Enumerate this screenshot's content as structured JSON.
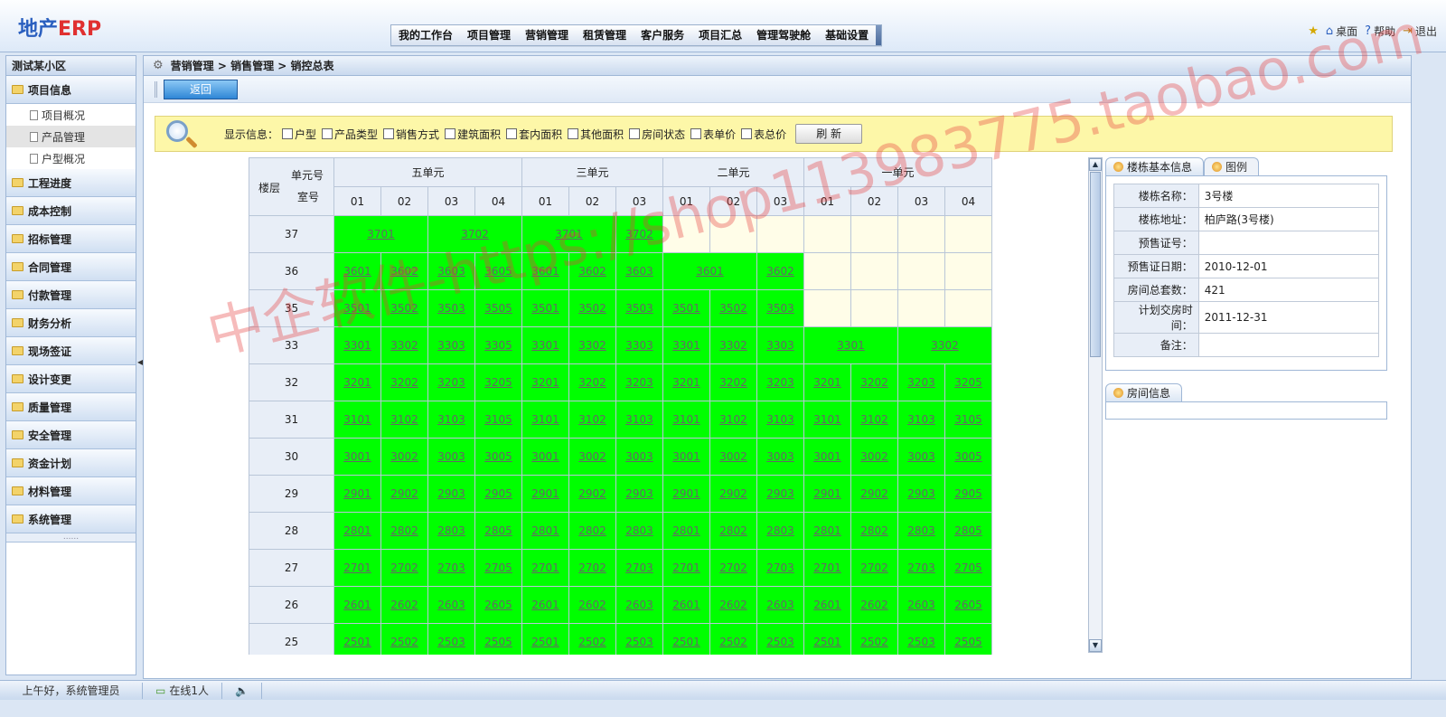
{
  "app": {
    "logo_prefix": "地产",
    "logo_suffix": "ERP"
  },
  "nav": [
    "我的工作台",
    "项目管理",
    "营销管理",
    "租赁管理",
    "客户服务",
    "项目汇总",
    "管理驾驶舱",
    "基础设置"
  ],
  "toplinks": {
    "desktop": "桌面",
    "help": "帮助",
    "logout": "退出"
  },
  "sidebar": {
    "title": "测试某小区",
    "groups": [
      "项目信息",
      "工程进度",
      "成本控制",
      "招标管理",
      "合同管理",
      "付款管理",
      "财务分析",
      "现场签证",
      "设计变更",
      "质量管理",
      "安全管理",
      "资金计划",
      "材料管理",
      "系统管理"
    ],
    "subitems": [
      "项目概况",
      "产品管理",
      "户型概况"
    ],
    "dots": "......"
  },
  "breadcrumb": "营销管理 > 销售管理 > 销控总表",
  "toolbar": {
    "back": "返回"
  },
  "filter": {
    "label": "显示信息：",
    "options": [
      "户型",
      "产品类型",
      "销售方式",
      "建筑面积",
      "套内面积",
      "其他面积",
      "房间状态",
      "表单价",
      "表总价"
    ],
    "refresh": "刷 新"
  },
  "grid": {
    "corner_floor": "楼层",
    "corner_unit": "单元号",
    "corner_room": "室号",
    "units": [
      {
        "name": "五单元",
        "rooms": [
          "01",
          "02",
          "03",
          "04"
        ]
      },
      {
        "name": "三单元",
        "rooms": [
          "01",
          "02",
          "03"
        ]
      },
      {
        "name": "二单元",
        "rooms": [
          "01",
          "02",
          "03"
        ]
      },
      {
        "name": "一单元",
        "rooms": [
          "01",
          "02",
          "03",
          "04"
        ]
      }
    ],
    "rows": [
      {
        "floor": "37",
        "cells": [
          [
            "3701",
            2
          ],
          [
            "3702",
            2
          ],
          [
            "3701",
            2
          ],
          [
            "3702",
            1
          ],
          [
            "",
            1
          ],
          [
            "",
            1
          ],
          [
            "",
            1
          ],
          [
            "",
            1
          ],
          [
            "",
            1
          ],
          [
            "",
            1
          ],
          [
            "",
            1
          ]
        ]
      },
      {
        "floor": "36",
        "cells": [
          [
            "3601",
            1
          ],
          [
            "3602",
            1
          ],
          [
            "3603",
            1
          ],
          [
            "3605",
            1
          ],
          [
            "3601",
            1
          ],
          [
            "3602",
            1
          ],
          [
            "3603",
            1
          ],
          [
            "3601",
            2
          ],
          [
            "3602",
            1
          ],
          [
            "",
            1
          ],
          [
            "",
            1
          ],
          [
            "",
            1
          ],
          [
            "",
            1
          ]
        ]
      },
      {
        "floor": "35",
        "cells": [
          [
            "3501",
            1
          ],
          [
            "3502",
            1
          ],
          [
            "3503",
            1
          ],
          [
            "3505",
            1
          ],
          [
            "3501",
            1
          ],
          [
            "3502",
            1
          ],
          [
            "3503",
            1
          ],
          [
            "3501",
            1
          ],
          [
            "3502",
            1
          ],
          [
            "3503",
            1
          ],
          [
            "",
            1
          ],
          [
            "",
            1
          ],
          [
            "",
            1
          ],
          [
            "",
            1
          ]
        ]
      },
      {
        "floor": "33",
        "cells": [
          [
            "3301",
            1
          ],
          [
            "3302",
            1
          ],
          [
            "3303",
            1
          ],
          [
            "3305",
            1
          ],
          [
            "3301",
            1
          ],
          [
            "3302",
            1
          ],
          [
            "3303",
            1
          ],
          [
            "3301",
            1
          ],
          [
            "3302",
            1
          ],
          [
            "3303",
            1
          ],
          [
            "3301",
            2
          ],
          [
            "3302",
            2
          ]
        ]
      },
      {
        "floor": "32",
        "cells": [
          [
            "3201",
            1
          ],
          [
            "3202",
            1
          ],
          [
            "3203",
            1
          ],
          [
            "3205",
            1
          ],
          [
            "3201",
            1
          ],
          [
            "3202",
            1
          ],
          [
            "3203",
            1
          ],
          [
            "3201",
            1
          ],
          [
            "3202",
            1
          ],
          [
            "3203",
            1
          ],
          [
            "3201",
            1
          ],
          [
            "3202",
            1
          ],
          [
            "3203",
            1
          ],
          [
            "3205",
            1
          ]
        ]
      },
      {
        "floor": "31",
        "cells": [
          [
            "3101",
            1
          ],
          [
            "3102",
            1
          ],
          [
            "3103",
            1
          ],
          [
            "3105",
            1
          ],
          [
            "3101",
            1
          ],
          [
            "3102",
            1
          ],
          [
            "3103",
            1
          ],
          [
            "3101",
            1
          ],
          [
            "3102",
            1
          ],
          [
            "3103",
            1
          ],
          [
            "3101",
            1
          ],
          [
            "3102",
            1
          ],
          [
            "3103",
            1
          ],
          [
            "3105",
            1
          ]
        ]
      },
      {
        "floor": "30",
        "cells": [
          [
            "3001",
            1
          ],
          [
            "3002",
            1
          ],
          [
            "3003",
            1
          ],
          [
            "3005",
            1
          ],
          [
            "3001",
            1
          ],
          [
            "3002",
            1
          ],
          [
            "3003",
            1
          ],
          [
            "3001",
            1
          ],
          [
            "3002",
            1
          ],
          [
            "3003",
            1
          ],
          [
            "3001",
            1
          ],
          [
            "3002",
            1
          ],
          [
            "3003",
            1
          ],
          [
            "3005",
            1
          ]
        ]
      },
      {
        "floor": "29",
        "cells": [
          [
            "2901",
            1
          ],
          [
            "2902",
            1
          ],
          [
            "2903",
            1
          ],
          [
            "2905",
            1
          ],
          [
            "2901",
            1
          ],
          [
            "2902",
            1
          ],
          [
            "2903",
            1
          ],
          [
            "2901",
            1
          ],
          [
            "2902",
            1
          ],
          [
            "2903",
            1
          ],
          [
            "2901",
            1
          ],
          [
            "2902",
            1
          ],
          [
            "2903",
            1
          ],
          [
            "2905",
            1
          ]
        ]
      },
      {
        "floor": "28",
        "cells": [
          [
            "2801",
            1
          ],
          [
            "2802",
            1
          ],
          [
            "2803",
            1
          ],
          [
            "2805",
            1
          ],
          [
            "2801",
            1
          ],
          [
            "2802",
            1
          ],
          [
            "2803",
            1
          ],
          [
            "2801",
            1
          ],
          [
            "2802",
            1
          ],
          [
            "2803",
            1
          ],
          [
            "2801",
            1
          ],
          [
            "2802",
            1
          ],
          [
            "2803",
            1
          ],
          [
            "2805",
            1
          ]
        ]
      },
      {
        "floor": "27",
        "cells": [
          [
            "2701",
            1
          ],
          [
            "2702",
            1
          ],
          [
            "2703",
            1
          ],
          [
            "2705",
            1
          ],
          [
            "2701",
            1
          ],
          [
            "2702",
            1
          ],
          [
            "2703",
            1
          ],
          [
            "2701",
            1
          ],
          [
            "2702",
            1
          ],
          [
            "2703",
            1
          ],
          [
            "2701",
            1
          ],
          [
            "2702",
            1
          ],
          [
            "2703",
            1
          ],
          [
            "2705",
            1
          ]
        ]
      },
      {
        "floor": "26",
        "cells": [
          [
            "2601",
            1
          ],
          [
            "2602",
            1
          ],
          [
            "2603",
            1
          ],
          [
            "2605",
            1
          ],
          [
            "2601",
            1
          ],
          [
            "2602",
            1
          ],
          [
            "2603",
            1
          ],
          [
            "2601",
            1
          ],
          [
            "2602",
            1
          ],
          [
            "2603",
            1
          ],
          [
            "2601",
            1
          ],
          [
            "2602",
            1
          ],
          [
            "2603",
            1
          ],
          [
            "2605",
            1
          ]
        ]
      },
      {
        "floor": "25",
        "cells": [
          [
            "2501",
            1
          ],
          [
            "2502",
            1
          ],
          [
            "2503",
            1
          ],
          [
            "2505",
            1
          ],
          [
            "2501",
            1
          ],
          [
            "2502",
            1
          ],
          [
            "2503",
            1
          ],
          [
            "2501",
            1
          ],
          [
            "2502",
            1
          ],
          [
            "2503",
            1
          ],
          [
            "2501",
            1
          ],
          [
            "2502",
            1
          ],
          [
            "2503",
            1
          ],
          [
            "2505",
            1
          ]
        ]
      }
    ]
  },
  "panel": {
    "tabs": [
      "楼栋基本信息",
      "图例"
    ],
    "info": [
      {
        "key": "楼栋名称：",
        "val": "3号楼"
      },
      {
        "key": "楼栋地址：",
        "val": "柏庐路(3号楼)"
      },
      {
        "key": "预售证号：",
        "val": ""
      },
      {
        "key": "预售证日期：",
        "val": "2010-12-01"
      },
      {
        "key": "房间总套数：",
        "val": "421"
      },
      {
        "key": "计划交房时间：",
        "val": "2011-12-31"
      },
      {
        "key": "备注：",
        "val": ""
      }
    ],
    "room_tab": "房间信息"
  },
  "status": {
    "greeting": "上午好，系统管理员",
    "online": "在线1人"
  },
  "watermark": "中企软件-https://shop113983775.taobao.com",
  "colors": {
    "sold": "#00ff00",
    "empty": "#fffde8",
    "accent": "#2a5fbf"
  }
}
